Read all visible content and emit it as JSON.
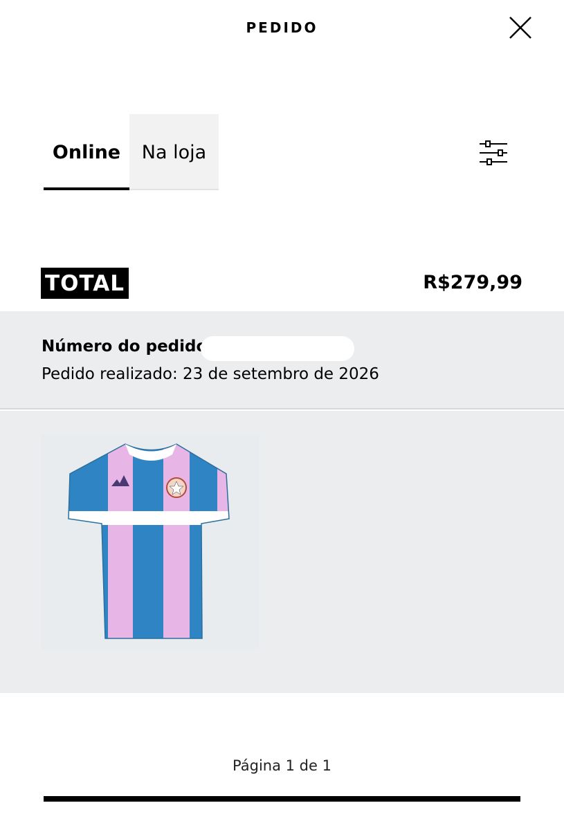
{
  "header": {
    "title": "PEDIDO",
    "close_icon": "close-icon"
  },
  "tabs": [
    {
      "label": "Online",
      "active": true
    },
    {
      "label": "Na loja",
      "active": false
    }
  ],
  "filter_icon": "sliders-icon",
  "summary": {
    "total_label": "TOTAL",
    "total_value": "R$279,99"
  },
  "order": {
    "number_label": "Número do pedido:",
    "date_text": "Pedido realizado: 23 de setembro de 2026"
  },
  "product": {
    "image": "jersey-image"
  },
  "pagination": {
    "text": "Página 1 de 1"
  },
  "colors": {
    "panel_bg": "#ebedee",
    "jersey_blue": "#2f84c4",
    "jersey_pink": "#e7b6e6"
  }
}
